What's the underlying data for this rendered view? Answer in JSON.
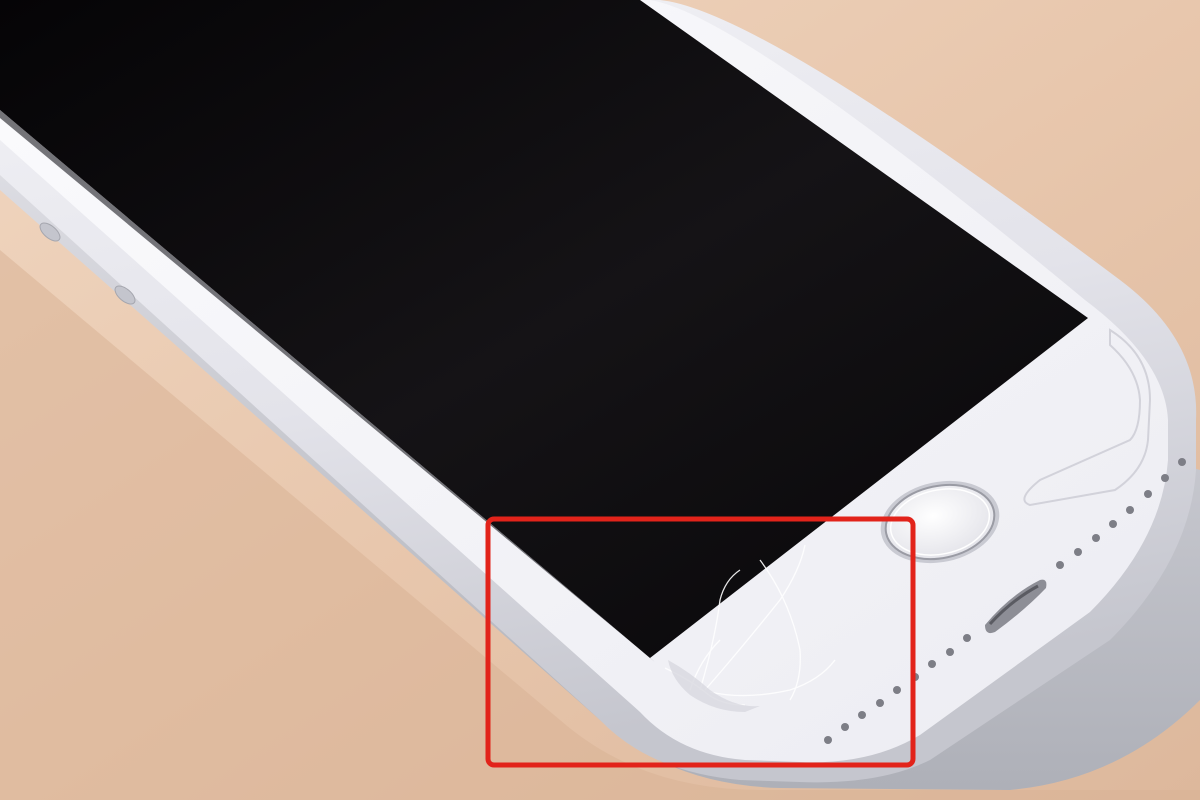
{
  "photo": {
    "subject": "phone",
    "colors": {
      "table": "#e8c7ad",
      "table_light": "#f0d6c0",
      "table_shadow": "#c9a68c",
      "body_silver": "#e6e6ec",
      "body_shadow": "#b8b9c2",
      "bezel_white": "#f4f4f8",
      "screen": "#0c0b0d",
      "highlight_box": "#e2231a"
    },
    "icons": [
      "home-button-icon",
      "lightning-port-icon",
      "speaker-grille-icon",
      "crack-lines-icon"
    ]
  }
}
